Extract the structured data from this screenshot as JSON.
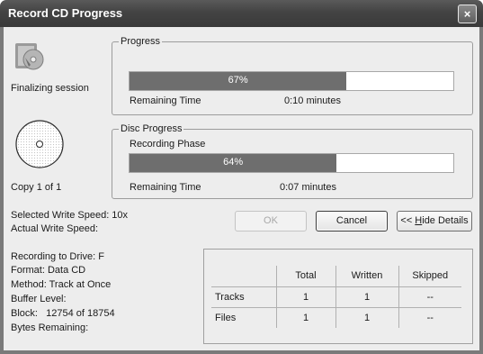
{
  "window": {
    "title": "Record CD Progress",
    "close_glyph": "×"
  },
  "status": {
    "finalizing": "Finalizing session",
    "copy": "Copy 1 of 1"
  },
  "progress": {
    "legend": "Progress",
    "percent_text": "67%",
    "fraction": 0.67,
    "remaining_label": "Remaining Time",
    "remaining_value": "0:10 minutes"
  },
  "disc_progress": {
    "legend": "Disc Progress",
    "phase": "Recording Phase",
    "percent_text": "64%",
    "fraction": 0.64,
    "remaining_label": "Remaining Time",
    "remaining_value": "0:07 minutes"
  },
  "speed": {
    "selected": "Selected Write Speed: 10x",
    "actual": "Actual Write Speed:"
  },
  "buttons": {
    "ok": "OK",
    "cancel": "Cancel",
    "hide_prefix": "<< ",
    "hide_hotkey": "H",
    "hide_rest": "ide Details"
  },
  "details": {
    "drive": "Recording to Drive: F",
    "format": "Format: Data CD",
    "method": "Method: Track at Once",
    "buffer": "Buffer Level:",
    "block": "Block:   12754 of 18754",
    "bytes": "Bytes Remaining:"
  },
  "table": {
    "headers": [
      "",
      "Total",
      "Written",
      "Skipped"
    ],
    "rows": [
      {
        "label": "Tracks",
        "total": "1",
        "written": "1",
        "skipped": "--"
      },
      {
        "label": "Files",
        "total": "1",
        "written": "1",
        "skipped": "--"
      }
    ]
  },
  "icons": {
    "app": "cd-burn-icon",
    "disc": "disc-icon"
  }
}
